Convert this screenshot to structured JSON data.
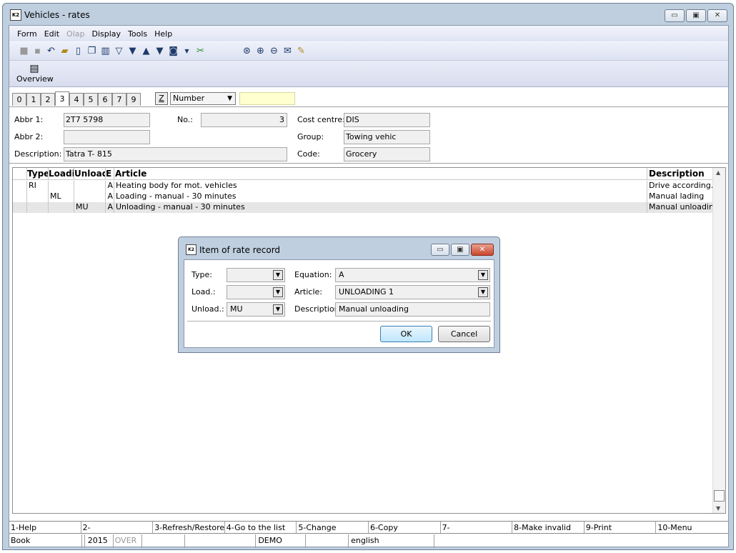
{
  "window": {
    "title": "Vehicles - rates",
    "icon": "K2",
    "buttons": {
      "minimize": "▭",
      "maximize": "▣",
      "close": "✕"
    }
  },
  "menu": [
    "Form",
    "Edit",
    "Olap",
    "Display",
    "Tools",
    "Help"
  ],
  "toolbar": {
    "icons": [
      "save-icon",
      "save-as-icon",
      "undo-icon",
      "open-folder-icon",
      "new-document-icon",
      "copy-icon",
      "book-icon",
      "filter-icon",
      "delete-filter-icon",
      "up-arrow-icon",
      "down-arrow-icon",
      "camera-icon",
      "dropdown-icon",
      "tools-icon"
    ],
    "right_icons": [
      "find-icon",
      "find-next-icon",
      "find-previous-icon",
      "mail-icon",
      "notes-icon"
    ]
  },
  "overview": {
    "label": "Overview"
  },
  "tabs": [
    "0",
    "1",
    "2",
    "3",
    "4",
    "5",
    "6",
    "7",
    "9"
  ],
  "active_tab": "3",
  "sort": {
    "z_label": "Z",
    "selected": "Number"
  },
  "form": {
    "abbr1_label": "Abbr 1:",
    "abbr1": "2T7 5798",
    "no_label": "No.:",
    "no": "3",
    "cost_centre_label": "Cost centre:",
    "cost_centre": "DIS",
    "abbr2_label": "Abbr 2:",
    "abbr2": "",
    "group_label": "Group:",
    "group": "Towing vehic",
    "description_label": "Description:",
    "description": "Tatra T- 815",
    "code_label": "Code:",
    "code": "Grocery"
  },
  "grid": {
    "headers": [
      "Type",
      "Loadi",
      "Unload",
      "E",
      "Article",
      "Description"
    ],
    "rows": [
      [
        "RI",
        "",
        "",
        "A",
        "Heating body for mot. vehicles",
        "Drive according..."
      ],
      [
        "",
        "ML",
        "",
        "A",
        "Loading - manual - 30 minutes",
        "Manual lading"
      ],
      [
        "",
        "",
        "MU",
        "A",
        "Unloading - manual - 30 minutes",
        "Manual unloading"
      ]
    ]
  },
  "fkeys": [
    "1-Help",
    "2-",
    "3-Refresh/Restore",
    "4-Go to the list",
    "5-Change",
    "6-Copy",
    "7-",
    "8-Make invalid",
    "9-Print",
    "10-Menu"
  ],
  "status": [
    "Book",
    "",
    "2015",
    "OVER",
    "",
    "",
    "DEMO",
    "",
    "english",
    ""
  ],
  "dialog": {
    "title": "Item of rate record",
    "type_label": "Type:",
    "type": "",
    "load_label": "Load.:",
    "load": "",
    "unload_label": "Unload.:",
    "unload": "MU",
    "equation_label": "Equation:",
    "equation": "A",
    "article_label": "Article:",
    "article": "UNLOADING 1",
    "description_label": "Description:",
    "description": "Manual unloading",
    "ok": "OK",
    "cancel": "Cancel"
  }
}
